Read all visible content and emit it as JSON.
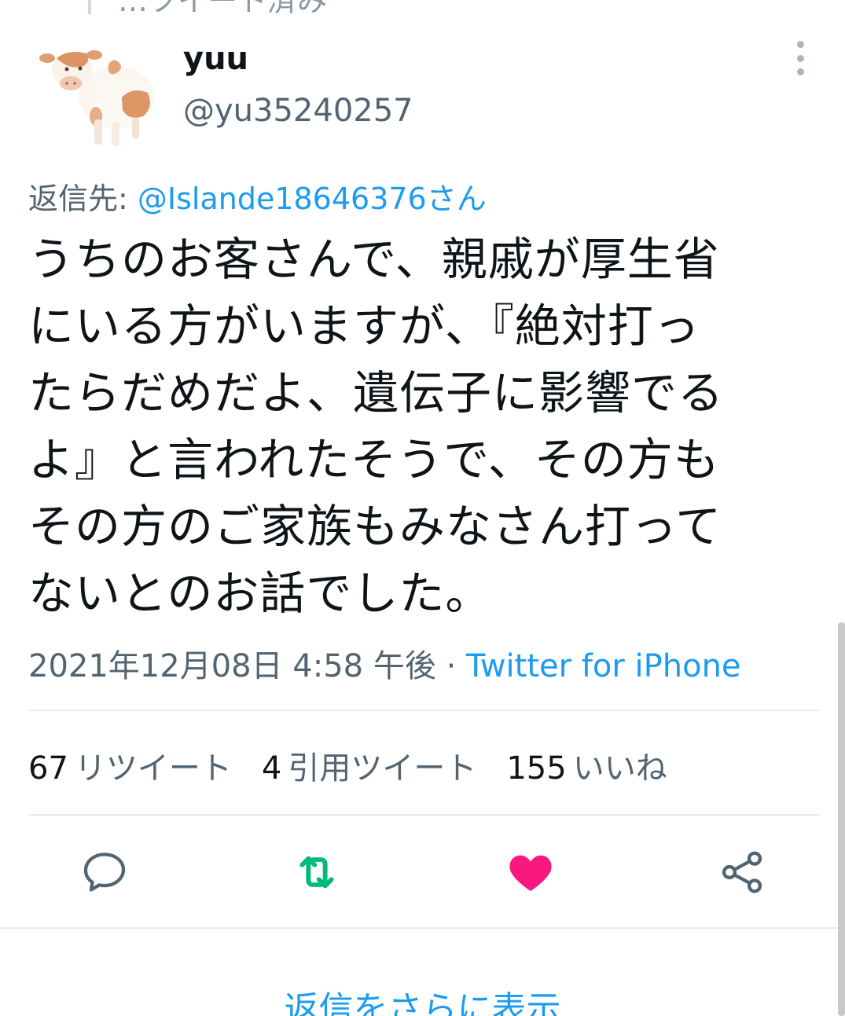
{
  "previous_tweet": {
    "text": "…ツイート済み"
  },
  "tweet": {
    "display_name": "yuu",
    "handle": "@yu35240257",
    "reply_to_label": "返信先: ",
    "reply_to_mention": "@Islande18646376さん",
    "body_lines": [
      "うちのお客さんで、親戚が厚生省",
      "にいる方がいますが、『絶対打っ",
      "たらだめだよ、遺伝子に影響でる",
      "よ』と言われたそうで、その方も",
      "その方のご家族もみなさん打って",
      "ないとのお話でした。"
    ],
    "timestamp": "2021年12月08日 4:58 午後",
    "separator": " · ",
    "source": "Twitter for iPhone"
  },
  "stats": {
    "retweets": {
      "count": "67",
      "label": "リツイート"
    },
    "quotes": {
      "count": "4",
      "label": "引用ツイート"
    },
    "likes": {
      "count": "155",
      "label": "いいね"
    }
  },
  "actions": {
    "reply_icon": "reply-icon",
    "retweet_icon": "retweet-icon",
    "like_icon": "heart-icon",
    "share_icon": "share-icon"
  },
  "show_more_replies": "返信をさらに表示",
  "colors": {
    "link": "#1d9bf0",
    "retweet_active": "#00ba7c",
    "like_active": "#f91880",
    "secondary_text": "#536471"
  }
}
